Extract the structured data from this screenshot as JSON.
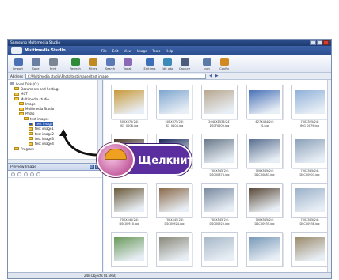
{
  "window": {
    "title": "Samsung Multimedia Studio"
  },
  "header": {
    "brand": "Multimedia Studio",
    "menu": [
      "File",
      "Edit",
      "View",
      "Image",
      "Tools",
      "Help"
    ]
  },
  "toolbar": [
    {
      "label": "Import",
      "icon": "import-icon",
      "color": "#4a6fb5"
    },
    {
      "label": "Save",
      "icon": "save-icon",
      "color": "#6b7fa5"
    },
    {
      "label": "Print",
      "icon": "print-icon",
      "color": "#7a8596"
    },
    {
      "label": "Refresh",
      "icon": "refresh-icon",
      "color": "#2f8a3a"
    },
    {
      "label": "Filters",
      "icon": "filters-icon",
      "color": "#c08a20"
    },
    {
      "label": "Search",
      "icon": "search-icon",
      "color": "#5d7ab8"
    },
    {
      "label": "Tweak",
      "icon": "tweak-icon",
      "color": "#8a6ab5"
    },
    {
      "label": "Edit img",
      "icon": "edit-image-icon",
      "color": "#3c6fb8"
    },
    {
      "label": "Edit vdo",
      "icon": "edit-video-icon",
      "color": "#3c8ab8"
    },
    {
      "label": "Capture",
      "icon": "capture-icon",
      "color": "#4a5c7a"
    },
    {
      "label": "Icon",
      "icon": "icon-view-icon",
      "color": "#5a7aa8"
    },
    {
      "label": "Config",
      "icon": "config-icon",
      "color": "#d08a20"
    }
  ],
  "address": {
    "label": "Address",
    "value": "C:\\Multimedia studio\\Photo\\test images\\test image"
  },
  "tree": {
    "items": [
      {
        "label": "Local Disk (C:)",
        "indent": 0,
        "kind": "drive"
      },
      {
        "label": "Documents and Settings",
        "indent": 1,
        "kind": "folder"
      },
      {
        "label": "MCT",
        "indent": 1,
        "kind": "folder"
      },
      {
        "label": "Multimedia studio",
        "indent": 1,
        "kind": "folder"
      },
      {
        "label": "Image",
        "indent": 2,
        "kind": "folder"
      },
      {
        "label": "Multimedia Studio",
        "indent": 2,
        "kind": "folder"
      },
      {
        "label": "Photo",
        "indent": 2,
        "kind": "folder"
      },
      {
        "label": "test images",
        "indent": 3,
        "kind": "folder"
      },
      {
        "label": "test image",
        "indent": 4,
        "kind": "folder",
        "selected": true
      },
      {
        "label": "test image1",
        "indent": 4,
        "kind": "folder"
      },
      {
        "label": "test image2",
        "indent": 4,
        "kind": "folder"
      },
      {
        "label": "test image3",
        "indent": 4,
        "kind": "folder"
      },
      {
        "label": "test image4",
        "indent": 4,
        "kind": "folder"
      },
      {
        "label": "Program",
        "indent": 1,
        "kind": "folder"
      }
    ]
  },
  "preview": {
    "title": "Preview Image"
  },
  "thumbnails": [
    {
      "caption1": "500X375(24)",
      "caption2": "IS1_0006.jpg",
      "color": "#c89a3a"
    },
    {
      "caption1": "500X375(24)",
      "caption2": "IS1_0104.jpg",
      "color": "#7fa6cf"
    },
    {
      "caption1": "2048X1536(24)",
      "caption2": "DSCF0209.jpg",
      "color": "#b8a890"
    },
    {
      "caption1": "627X464(24)",
      "caption2": "IS.jpg",
      "color": "#4a72b8"
    },
    {
      "caption1": "700X525(24)",
      "caption2": "IMG_0079.jpg",
      "color": "#8fb0d8"
    },
    {
      "caption1": "",
      "caption2": "",
      "color": "#4a3a2a"
    },
    {
      "caption1": "",
      "caption2": "",
      "color": "#1a2a5a"
    },
    {
      "caption1": "700X545(24)",
      "caption2": "DSC00876.jpg",
      "color": "#6a7a8a"
    },
    {
      "caption1": "700X545(24)",
      "caption2": "DSC00883.jpg",
      "color": "#5a7090"
    },
    {
      "caption1": "700X545(24)",
      "caption2": "DSC00903.jpg",
      "color": "#8aa0b8"
    },
    {
      "caption1": "700X545(24)",
      "caption2": "DSC00910.jpg",
      "color": "#6a5a3a"
    },
    {
      "caption1": "700X545(24)",
      "caption2": "DSC00924.jpg",
      "color": "#8a6a4a"
    },
    {
      "caption1": "700X545(24)",
      "caption2": "DSC00925.jpg",
      "color": "#7a8aa0"
    },
    {
      "caption1": "700X545(24)",
      "caption2": "DSC00935.jpg",
      "color": "#5a4a3a"
    },
    {
      "caption1": "700X545(24)",
      "caption2": "DSC00938.jpg",
      "color": "#9ab0c8"
    },
    {
      "caption1": "",
      "caption2": "",
      "color": "#6a9a5a"
    },
    {
      "caption1": "",
      "caption2": "",
      "color": "#8a8a7a"
    },
    {
      "caption1": "",
      "caption2": "",
      "color": "#a8b8c8"
    },
    {
      "caption1": "",
      "caption2": "",
      "color": "#7a9ab8"
    },
    {
      "caption1": "",
      "caption2": "",
      "color": "#9a8a6a"
    }
  ],
  "status": {
    "text": "24k Objects (4.5MB)"
  },
  "callout": {
    "text": "Щелкните"
  }
}
